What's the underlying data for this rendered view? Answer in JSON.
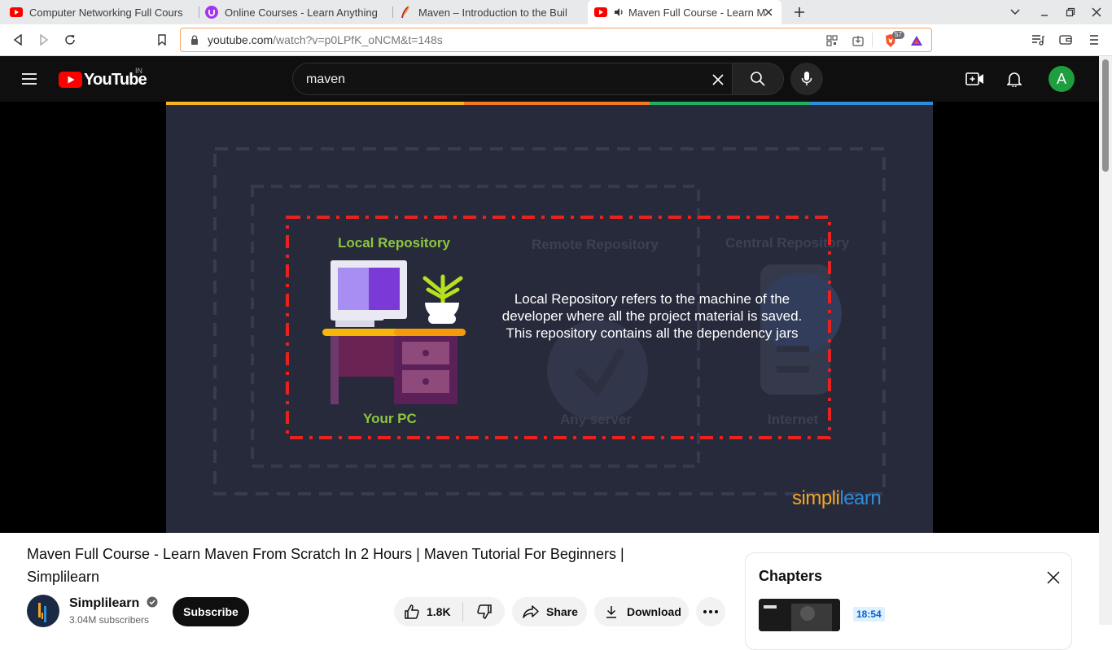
{
  "browser": {
    "tabs": [
      {
        "title": "Computer Networking Full Cours",
        "favicon": "youtube-icon",
        "active": false
      },
      {
        "title": "Online Courses - Learn Anything",
        "favicon": "udemy-icon",
        "active": false
      },
      {
        "title": "Maven – Introduction to the Buil",
        "favicon": "maven-feather-icon",
        "active": false
      },
      {
        "title": "Maven Full Course - Learn M",
        "favicon": "youtube-icon",
        "active": true
      }
    ],
    "url": {
      "host": "youtube.com",
      "path": "/watch?v=p0LPfK_oNCM&t=148s"
    },
    "brave_shield_count": "57"
  },
  "youtube": {
    "logo_text": "YouTube",
    "region": "IN",
    "search_value": "maven",
    "avatar_letter": "A",
    "avatar_color": "#1e9e3e"
  },
  "video_frame": {
    "local_repository": "Local Repository",
    "remote_repository": "Remote Repository",
    "central_repository": "Central Repository",
    "your_pc": "Your PC",
    "any_server": "Any server",
    "internet": "Internet",
    "description": "Local Repository refers to the machine of the developer where all the project material is saved. This repository contains all the dependency jars",
    "brand": {
      "part1": "simpl",
      "part2": "i",
      "part3": "learn"
    }
  },
  "video": {
    "title": "Maven Full Course - Learn Maven From Scratch In 2 Hours | Maven Tutorial For Beginners | Simplilearn",
    "channel": "Simplilearn",
    "subscribers": "3.04M subscribers",
    "subscribe_label": "Subscribe",
    "likes": "1.8K",
    "share_label": "Share",
    "download_label": "Download"
  },
  "chapters": {
    "title": "Chapters",
    "first_time": "18:54"
  }
}
